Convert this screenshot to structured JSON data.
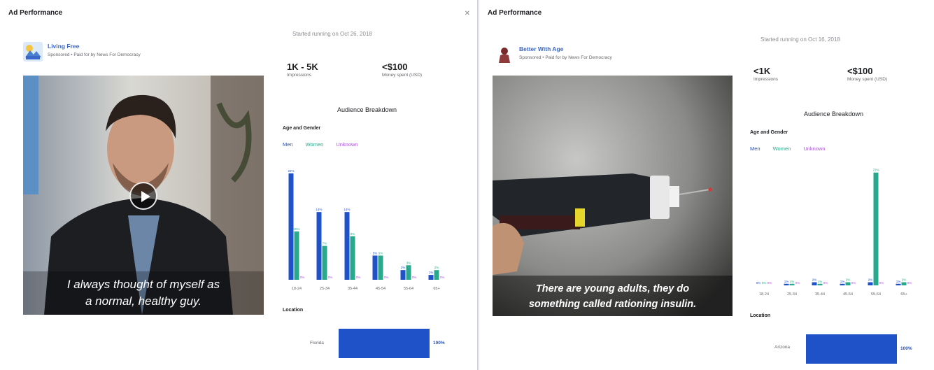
{
  "colors": {
    "men": "#1f51c9",
    "women": "#28a98c",
    "unknown": "#a855d6",
    "link": "#3a67c8"
  },
  "left": {
    "title": "Ad Performance",
    "started": "Started running on Oct 26, 2018",
    "page_name": "Living Free",
    "sponsored": "Sponsored • Paid for by News For Democracy",
    "caption_line1": "I always thought of myself as",
    "caption_line2": "a normal, healthy guy.",
    "impressions": {
      "value": "1K - 5K",
      "label": "Impressions"
    },
    "spend": {
      "value": "<$100",
      "label": "Money spent (USD)"
    },
    "audience_title": "Audience Breakdown",
    "age_gender_title": "Age and Gender",
    "legend": {
      "men": "Men",
      "women": "Women",
      "unknown": "Unknown"
    },
    "location_title": "Location",
    "location_label": "Florida",
    "location_pct": "100%"
  },
  "right": {
    "title": "Ad Performance",
    "started": "Started running on Oct 16, 2018",
    "page_name": "Better With Age",
    "sponsored": "Sponsored • Paid for by News For Democracy",
    "caption_line1": "There are young adults, they do",
    "caption_line2": "something called rationing insulin.",
    "impressions": {
      "value": "<1K",
      "label": "Impressions"
    },
    "spend": {
      "value": "<$100",
      "label": "Money spent (USD)"
    },
    "audience_title": "Audience Breakdown",
    "age_gender_title": "Age and Gender",
    "legend": {
      "men": "Men",
      "women": "Women",
      "unknown": "Unknown"
    },
    "location_title": "Location",
    "location_label": "Arizona",
    "location_pct": "100%"
  },
  "chart_data": [
    {
      "type": "bar",
      "title": "Age and Gender",
      "categories": [
        "18-24",
        "25-34",
        "35-44",
        "45-54",
        "55-64",
        "65+"
      ],
      "series": [
        {
          "name": "Men",
          "values": [
            22,
            14,
            14,
            5,
            2,
            1
          ]
        },
        {
          "name": "Women",
          "values": [
            10,
            7,
            9,
            5,
            3,
            2
          ]
        },
        {
          "name": "Unknown",
          "values": [
            0,
            0,
            0,
            0,
            0,
            0
          ]
        }
      ],
      "value_labels": {
        "Men": [
          "22%",
          "14%",
          "14%",
          "5%",
          "2%",
          "1%"
        ],
        "Women": [
          "10%",
          "7%",
          "9%",
          "5%",
          "3%",
          "2%"
        ],
        "Unknown": [
          "0%",
          "0%",
          "0%",
          "0%",
          "0%",
          "0%"
        ]
      },
      "ylim": [
        0,
        24
      ]
    },
    {
      "type": "bar",
      "title": "Age and Gender",
      "categories": [
        "18-24",
        "25-34",
        "35-44",
        "45-54",
        "55-64",
        "65+"
      ],
      "series": [
        {
          "name": "Men",
          "values": [
            0,
            1,
            2,
            1,
            2,
            1
          ]
        },
        {
          "name": "Women",
          "values": [
            0,
            1,
            1,
            2,
            72,
            2
          ]
        },
        {
          "name": "Unknown",
          "values": [
            0,
            0,
            0,
            0,
            0,
            0
          ]
        }
      ],
      "value_labels": {
        "Men": [
          "0%",
          "1%",
          "2%",
          "1%",
          "2%",
          "1%"
        ],
        "Women": [
          "0%",
          "1%",
          "1%",
          "2%",
          "72%",
          "2%"
        ],
        "Unknown": [
          "0%",
          "0%",
          "0%",
          "0%",
          "0%",
          "0%"
        ]
      },
      "ylim": [
        0,
        75
      ]
    }
  ]
}
